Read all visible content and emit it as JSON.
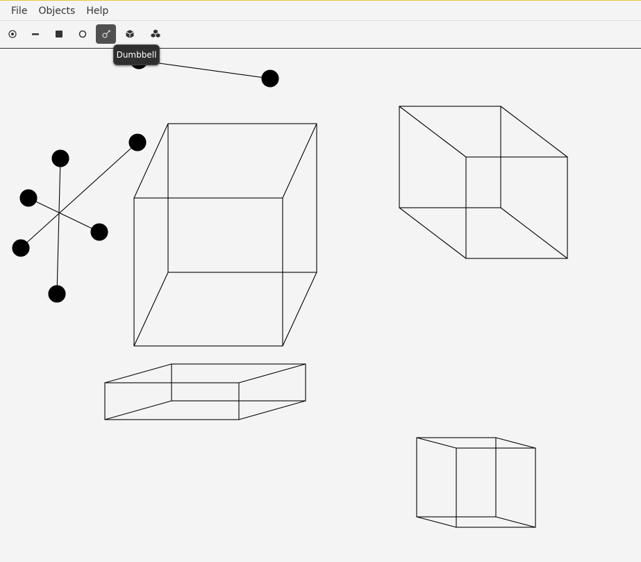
{
  "colors": {
    "accent_line": "#f0c23a",
    "active_tool_bg": "#505050",
    "tooltip_bg": "#2e2e2e",
    "stroke": "#000000",
    "canvas_bg": "#f4f4f4"
  },
  "menubar": {
    "items": [
      {
        "label": "File"
      },
      {
        "label": "Objects"
      },
      {
        "label": "Help"
      }
    ]
  },
  "toolbar": {
    "tools": [
      {
        "icon": "point-icon",
        "active": false
      },
      {
        "icon": "line-icon",
        "active": false
      },
      {
        "icon": "square-icon",
        "active": false
      },
      {
        "icon": "circle-icon",
        "active": false
      },
      {
        "icon": "dumbbell-icon",
        "active": true
      },
      {
        "icon": "cube-icon",
        "active": false
      },
      {
        "icon": "cubes-icon",
        "active": false
      }
    ]
  },
  "tooltip": {
    "text": "Dumbbell"
  },
  "canvas": {
    "objects": [
      {
        "type": "dumbbell",
        "name": "dumbbell-top"
      },
      {
        "type": "dumbbell",
        "name": "dumbbell-star-1"
      },
      {
        "type": "dumbbell",
        "name": "dumbbell-star-2"
      },
      {
        "type": "dumbbell",
        "name": "dumbbell-star-3"
      },
      {
        "type": "cube",
        "name": "large-cube"
      },
      {
        "type": "cube",
        "name": "right-cube"
      },
      {
        "type": "box",
        "name": "flat-box"
      },
      {
        "type": "cube",
        "name": "small-cube"
      }
    ]
  }
}
